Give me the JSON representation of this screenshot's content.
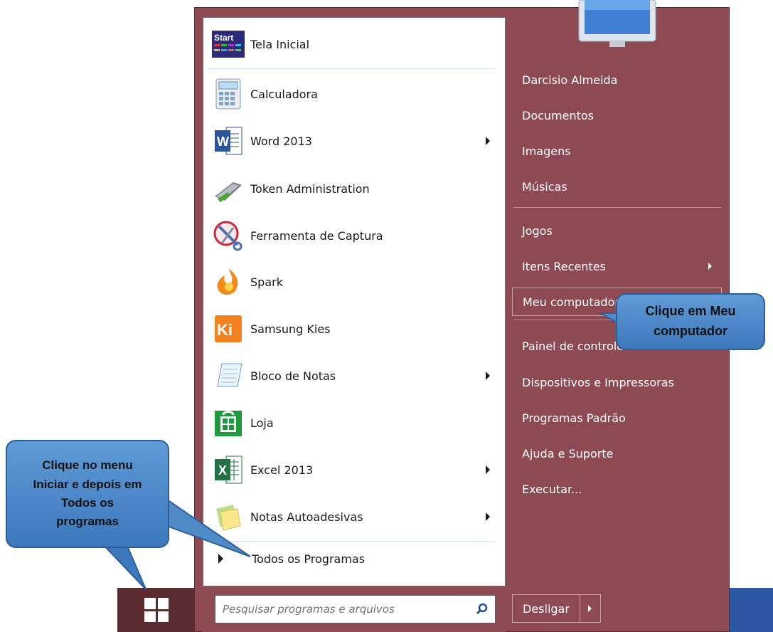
{
  "start_menu": {
    "programs": [
      {
        "label": "Tela Inicial",
        "icon": "start-screen-icon",
        "has_submenu": false
      },
      {
        "label": "Calculadora",
        "icon": "calculator-icon",
        "has_submenu": false
      },
      {
        "label": "Word 2013",
        "icon": "word-icon",
        "has_submenu": true
      },
      {
        "label": "Token Administration",
        "icon": "token-icon",
        "has_submenu": false
      },
      {
        "label": "Ferramenta de Captura",
        "icon": "snipping-tool-icon",
        "has_submenu": false
      },
      {
        "label": "Spark",
        "icon": "spark-icon",
        "has_submenu": false
      },
      {
        "label": "Samsung Kies",
        "icon": "kies-icon",
        "has_submenu": false
      },
      {
        "label": "Bloco de Notas",
        "icon": "notepad-icon",
        "has_submenu": true
      },
      {
        "label": "Loja",
        "icon": "store-icon",
        "has_submenu": false
      },
      {
        "label": "Excel 2013",
        "icon": "excel-icon",
        "has_submenu": true
      },
      {
        "label": "Notas Autoadesivas",
        "icon": "sticky-notes-icon",
        "has_submenu": true
      }
    ],
    "all_programs_label": "Todos os Programas",
    "search_placeholder": "Pesquisar programas e arquivos",
    "right_items": [
      {
        "label": "Darcisio Almeida"
      },
      {
        "label": "Documentos"
      },
      {
        "label": "Imagens"
      },
      {
        "label": "Músicas"
      },
      {
        "label": "Jogos"
      },
      {
        "label": "Itens Recentes",
        "has_submenu": true
      },
      {
        "label": "Meu computador",
        "highlighted": true
      },
      {
        "label": "Painel de controle"
      },
      {
        "label": "Dispositivos e Impressoras"
      },
      {
        "label": "Programas Padrão"
      },
      {
        "label": "Ajuda e Suporte"
      },
      {
        "label": "Executar..."
      }
    ],
    "shutdown_label": "Desligar"
  },
  "callouts": {
    "start_menu_tip": "Clique no menu\nIniciar e depois em\nTodos os\nprogramas",
    "computer_tip": "Clique em Meu\ncomputador"
  },
  "colors": {
    "menu_background": "#8d4a52",
    "callout_fill": "#4f8ac9",
    "taskbar": "#5b2c2f"
  }
}
